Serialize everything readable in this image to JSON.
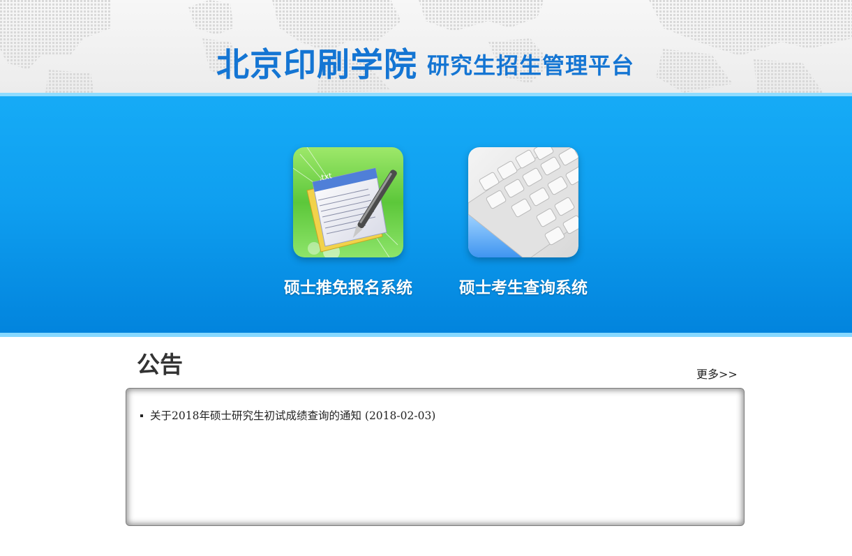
{
  "header": {
    "title_main": "北京印刷学院",
    "title_sub": "研究生招生管理平台"
  },
  "tiles": [
    {
      "label": "硕士推免报名系统",
      "icon": "txt-document-pen-icon"
    },
    {
      "label": "硕士考生查询系统",
      "icon": "keyboard-icon"
    }
  ],
  "notice": {
    "title": "公告",
    "more_label": "更多>>",
    "items": [
      {
        "text": "关于2018年硕士研究生初试成绩查询的通知",
        "date": "(2018-02-03)"
      }
    ]
  },
  "colors": {
    "title_blue": "#1475d3",
    "banner_blue": "#0f9ff0",
    "banner_border": "#8fdcff"
  }
}
